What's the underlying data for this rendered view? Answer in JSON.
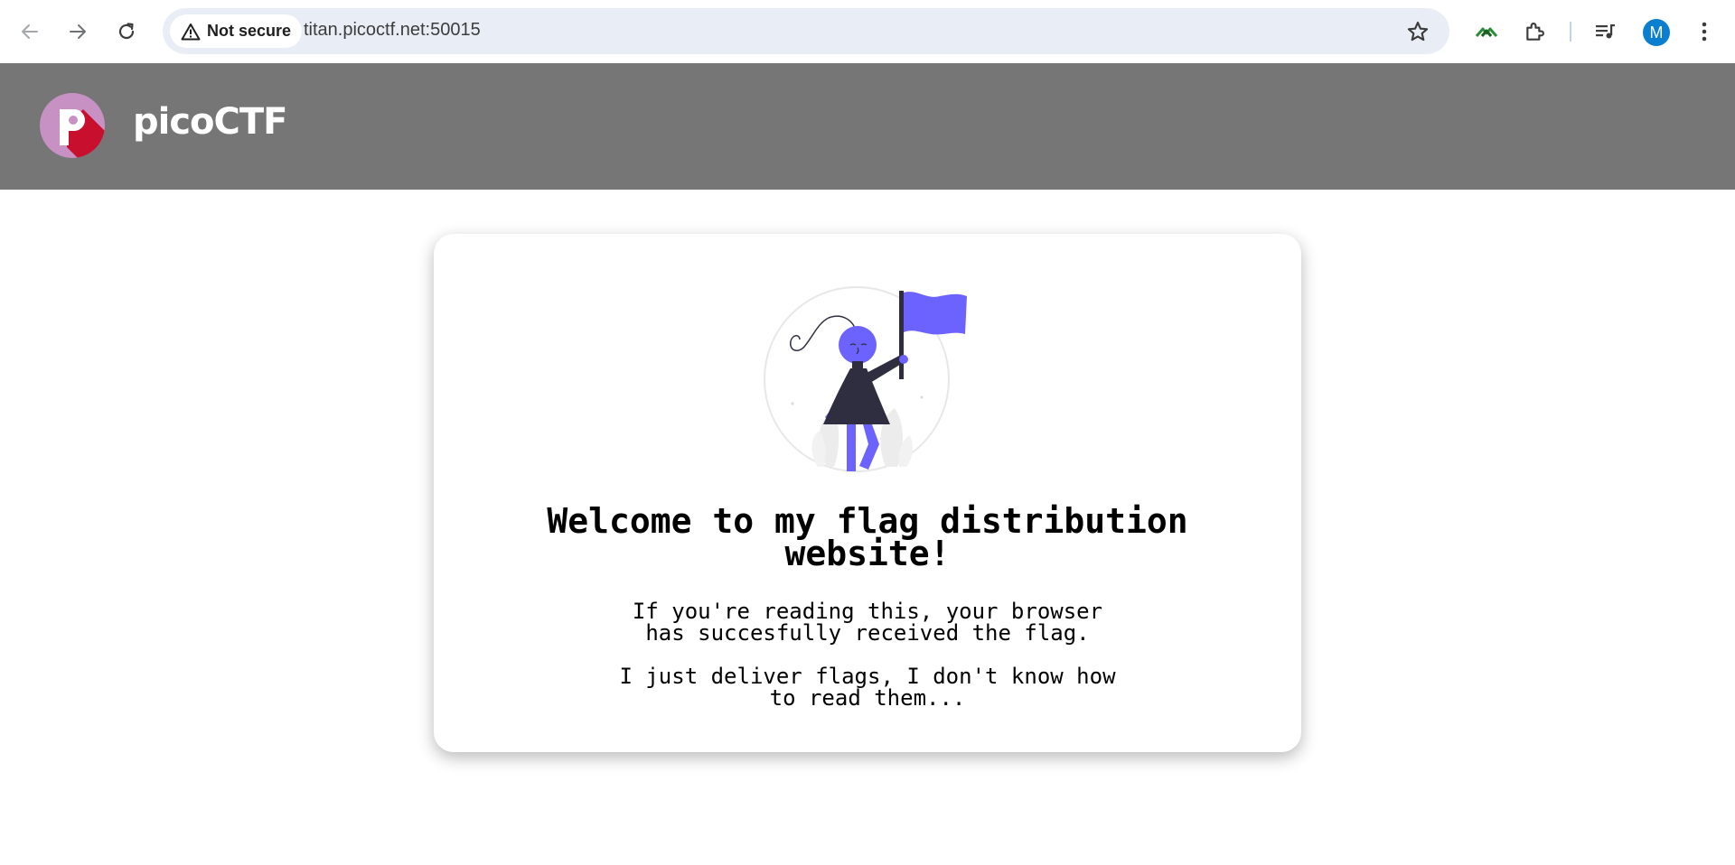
{
  "browser": {
    "security_label": "Not secure",
    "url": "titan.picoctf.net:50015",
    "avatar_initial": "M",
    "icons": {
      "back": "arrow-left-icon",
      "forward": "arrow-right-icon",
      "reload": "reload-icon",
      "warning": "warning-triangle-icon",
      "bookmark": "star-icon",
      "extension_app": "green-chevron-extension-icon",
      "extensions": "puzzle-piece-icon",
      "media": "media-queue-icon",
      "menu": "kebab-menu-icon"
    }
  },
  "header": {
    "brand": "picoCTF",
    "logo_icon": "picoctf-logo-icon",
    "background_color": "#767676"
  },
  "card": {
    "illustration": "person-holding-flag-illustration",
    "accent_color": "#6c63ff",
    "title": "Welcome to my flag distribution website!",
    "paragraph_1": {
      "line_1": "If you're reading this, your browser",
      "line_2": "has succesfully received the flag."
    },
    "paragraph_2": {
      "line_1": "I just deliver flags, I don't know how",
      "line_2": "to read them..."
    }
  }
}
